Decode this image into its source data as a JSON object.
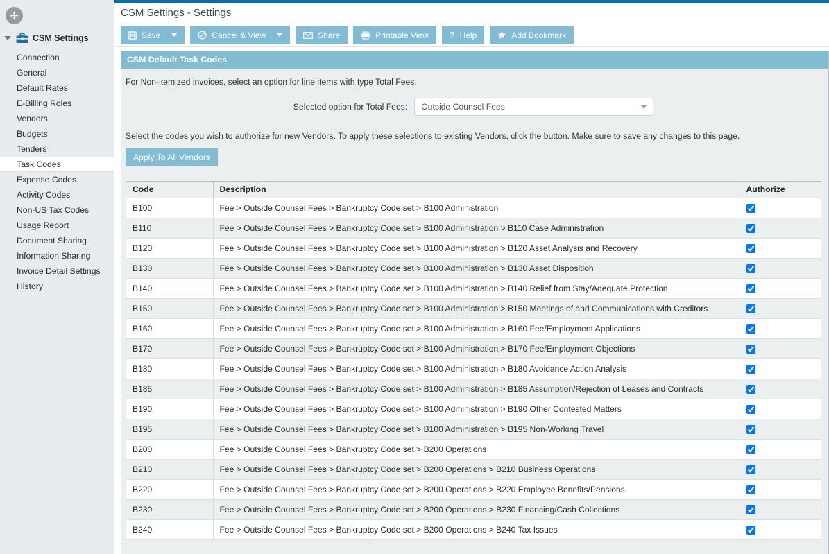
{
  "window": {
    "title": "CSM Settings - Settings",
    "accent_blue": "#0b6ca8",
    "button_blue": "#82bcd4",
    "panel_header_blue": "#81bcd3"
  },
  "sidebar": {
    "move_icon": "move-arrows-icon",
    "header": {
      "label": "CSM Settings",
      "icon": "briefcase-icon",
      "caret": "caret-down-icon"
    },
    "items": [
      {
        "label": "Connection",
        "active": false
      },
      {
        "label": "General",
        "active": false
      },
      {
        "label": "Default Rates",
        "active": false
      },
      {
        "label": "E-Billing Roles",
        "active": false
      },
      {
        "label": "Vendors",
        "active": false
      },
      {
        "label": "Budgets",
        "active": false
      },
      {
        "label": "Tenders",
        "active": false
      },
      {
        "label": "Task Codes",
        "active": true
      },
      {
        "label": "Expense Codes",
        "active": false
      },
      {
        "label": "Activity Codes",
        "active": false
      },
      {
        "label": "Non-US Tax Codes",
        "active": false
      },
      {
        "label": "Usage Report",
        "active": false
      },
      {
        "label": "Document Sharing",
        "active": false
      },
      {
        "label": "Information Sharing",
        "active": false
      },
      {
        "label": "Invoice Detail Settings",
        "active": false
      },
      {
        "label": "History",
        "active": false
      }
    ]
  },
  "toolbar": {
    "save_label": "Save",
    "cancel_view_label": "Cancel & View",
    "share_label": "Share",
    "printable_view_label": "Printable View",
    "help_label": "Help",
    "add_bookmark_label": "Add Bookmark"
  },
  "panel": {
    "header": "CSM Default Task Codes",
    "hint": "For Non-itemized invoices, select an option for line items with type Total Fees.",
    "dropdown_label": "Selected option for Total Fees:",
    "dropdown_value": "Outside Counsel Fees",
    "instructions": "Select the codes you wish to authorize for new Vendors. To apply these selections to existing Vendors, click the button. Make sure to save any changes to this page.",
    "apply_button": "Apply To All Vendors"
  },
  "table": {
    "columns": [
      "Code",
      "Description",
      "Authorize"
    ],
    "rows": [
      {
        "code": "B100",
        "description": "Fee > Outside Counsel Fees > Bankruptcy Code set > B100 Administration",
        "authorize": true
      },
      {
        "code": "B110",
        "description": "Fee > Outside Counsel Fees > Bankruptcy Code set > B100 Administration > B110 Case Administration",
        "authorize": true
      },
      {
        "code": "B120",
        "description": "Fee > Outside Counsel Fees > Bankruptcy Code set > B100 Administration > B120 Asset Analysis and Recovery",
        "authorize": true
      },
      {
        "code": "B130",
        "description": "Fee > Outside Counsel Fees > Bankruptcy Code set > B100 Administration > B130 Asset Disposition",
        "authorize": true
      },
      {
        "code": "B140",
        "description": "Fee > Outside Counsel Fees > Bankruptcy Code set > B100 Administration > B140 Relief from Stay/Adequate Protection",
        "authorize": true
      },
      {
        "code": "B150",
        "description": "Fee > Outside Counsel Fees > Bankruptcy Code set > B100 Administration > B150 Meetings of and Communications with Creditors",
        "authorize": true
      },
      {
        "code": "B160",
        "description": "Fee > Outside Counsel Fees > Bankruptcy Code set > B100 Administration > B160 Fee/Employment Applications",
        "authorize": true
      },
      {
        "code": "B170",
        "description": "Fee > Outside Counsel Fees > Bankruptcy Code set > B100 Administration > B170 Fee/Employment Objections",
        "authorize": true
      },
      {
        "code": "B180",
        "description": "Fee > Outside Counsel Fees > Bankruptcy Code set > B100 Administration > B180 Avoidance Action Analysis",
        "authorize": true
      },
      {
        "code": "B185",
        "description": "Fee > Outside Counsel Fees > Bankruptcy Code set > B100 Administration > B185 Assumption/Rejection of Leases and Contracts",
        "authorize": true
      },
      {
        "code": "B190",
        "description": "Fee > Outside Counsel Fees > Bankruptcy Code set > B100 Administration > B190 Other Contested Matters",
        "authorize": true
      },
      {
        "code": "B195",
        "description": "Fee > Outside Counsel Fees > Bankruptcy Code set > B100 Administration > B195 Non-Working Travel",
        "authorize": true
      },
      {
        "code": "B200",
        "description": "Fee > Outside Counsel Fees > Bankruptcy Code set > B200 Operations",
        "authorize": true
      },
      {
        "code": "B210",
        "description": "Fee > Outside Counsel Fees > Bankruptcy Code set > B200 Operations > B210 Business Operations",
        "authorize": true
      },
      {
        "code": "B220",
        "description": "Fee > Outside Counsel Fees > Bankruptcy Code set > B200 Operations > B220 Employee Benefits/Pensions",
        "authorize": true
      },
      {
        "code": "B230",
        "description": "Fee > Outside Counsel Fees > Bankruptcy Code set > B200 Operations > B230 Financing/Cash Collections",
        "authorize": true
      },
      {
        "code": "B240",
        "description": "Fee > Outside Counsel Fees > Bankruptcy Code set > B200 Operations > B240 Tax Issues",
        "authorize": true
      }
    ]
  }
}
